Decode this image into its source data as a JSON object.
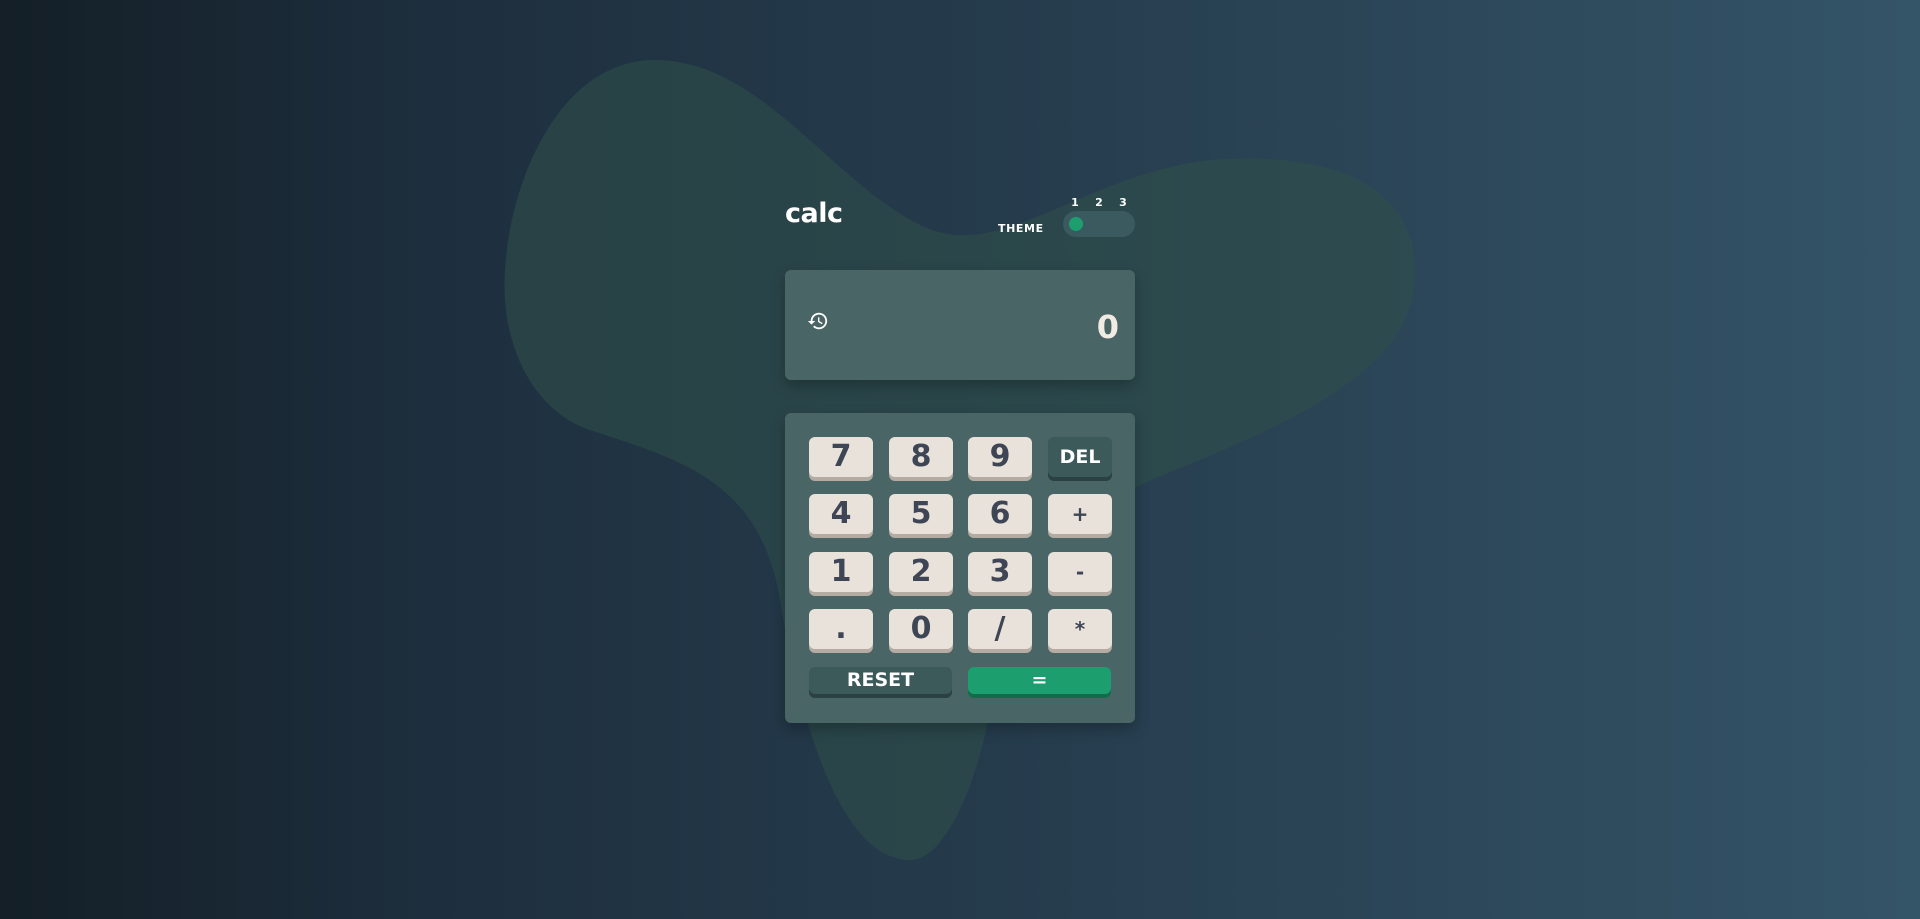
{
  "app": {
    "logo": "calc",
    "theme": {
      "label": "THEME",
      "options": [
        "1",
        "2",
        "3"
      ],
      "selected": "1",
      "accent_color": "#1c9e6e"
    }
  },
  "display": {
    "history_icon": "history-icon",
    "value": "0"
  },
  "keypad": {
    "row1": [
      "7",
      "8",
      "9",
      "DEL"
    ],
    "row2": [
      "4",
      "5",
      "6",
      "+"
    ],
    "row3": [
      "1",
      "2",
      "3",
      "-"
    ],
    "row4": [
      ".",
      "0",
      "/",
      "*"
    ],
    "reset_label": "RESET",
    "equals_label": "=",
    "colors": {
      "key": "#e9e2da",
      "key_text": "#3e4554",
      "del_reset": "#3d5a5b",
      "equals": "#1c9e6e",
      "panel": "#4a6565"
    }
  }
}
